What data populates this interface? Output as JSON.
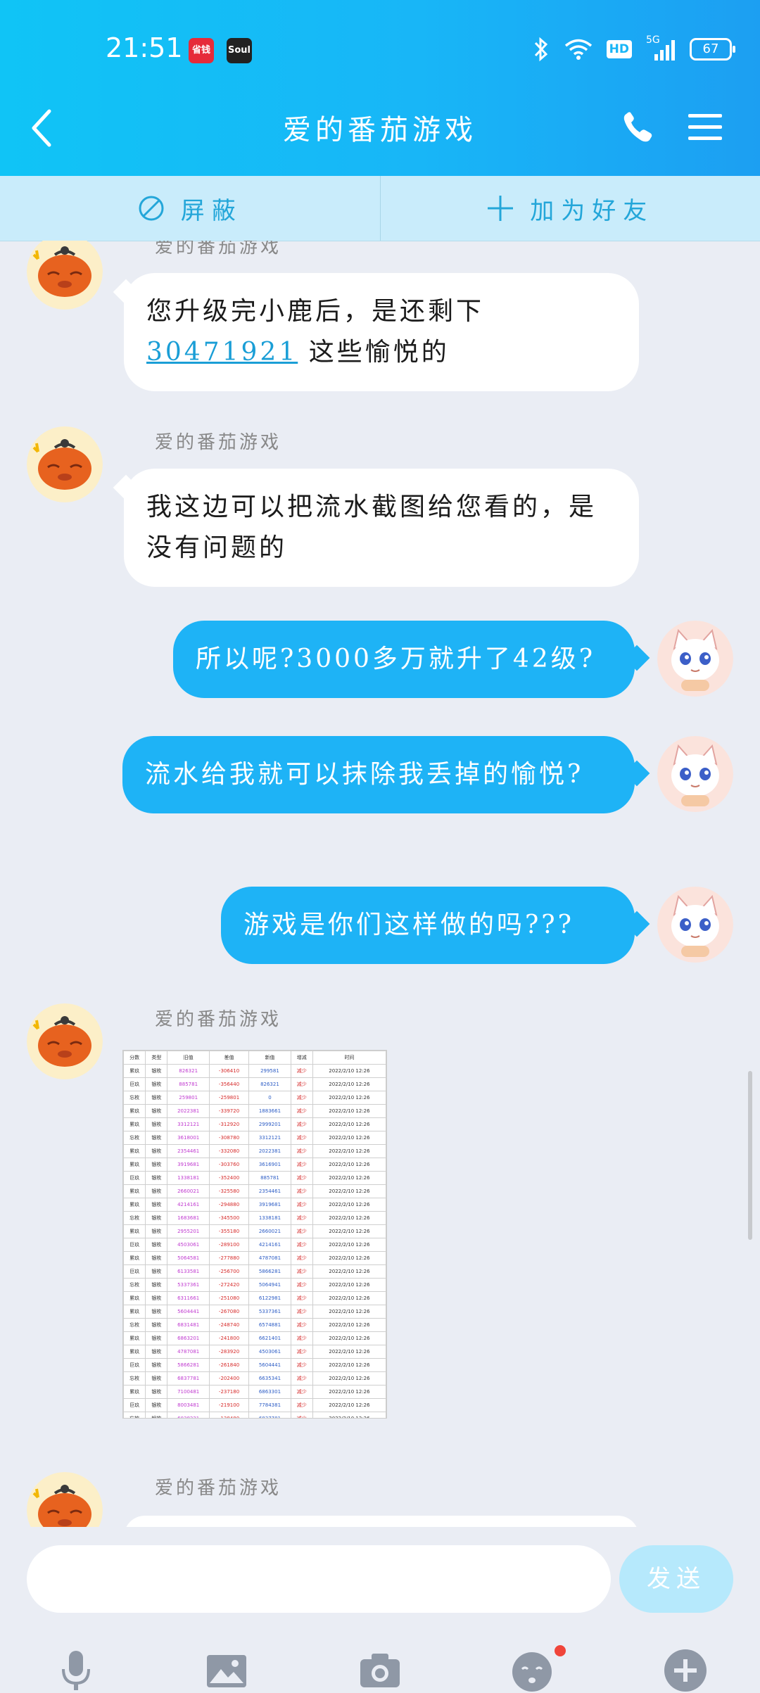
{
  "status_bar": {
    "time": "21:51",
    "app_badge_1": "省钱",
    "app_badge_2": "Soul",
    "network": "5G",
    "hd": "HD",
    "battery": "67"
  },
  "header": {
    "title": "爱的番茄游戏"
  },
  "actions": {
    "block_label": "屏蔽",
    "add_friend_label": "加为好友"
  },
  "messages": [
    {
      "from": "爱的番茄游戏",
      "text_before": "您升级完小鹿后，是还剩下",
      "link": "30471921",
      "text_after": "这些愉悦的"
    },
    {
      "from": "爱的番茄游戏",
      "text": "我这边可以把流水截图给您看的，是没有问题的"
    },
    {
      "from": "me",
      "text": "所以呢?3000多万就升了42级?"
    },
    {
      "from": "me",
      "text": "流水给我就可以抹除我丢掉的愉悦?"
    },
    {
      "from": "me",
      "text": "游戏是你们这样做的吗???"
    },
    {
      "from": "爱的番茄游戏",
      "type": "image"
    },
    {
      "from": "爱的番茄游戏"
    }
  ],
  "sheet": {
    "headers": [
      "分数",
      "类型",
      "旧值",
      "差值",
      "新值",
      "增减",
      "时间"
    ],
    "rows": [
      [
        "累玖",
        "银枚",
        "826321",
        "-306410",
        "299581",
        "减少",
        "2022/2/10 12:26"
      ],
      [
        "巨玖",
        "银枚",
        "885781",
        "-356440",
        "826321",
        "减少",
        "2022/2/10 12:26"
      ],
      [
        "忘枚",
        "银枚",
        "259801",
        "-259801",
        "0",
        "减少",
        "2022/2/10 12:26"
      ],
      [
        "累玖",
        "银枚",
        "2022381",
        "-339720",
        "1883661",
        "减少",
        "2022/2/10 12:26"
      ],
      [
        "累玖",
        "银枚",
        "3312121",
        "-312920",
        "2999201",
        "减少",
        "2022/2/10 12:26"
      ],
      [
        "忘枚",
        "银枚",
        "3618001",
        "-308780",
        "3312121",
        "减少",
        "2022/2/10 12:26"
      ],
      [
        "累玖",
        "银枚",
        "2354461",
        "-332080",
        "2022381",
        "减少",
        "2022/2/10 12:26"
      ],
      [
        "累玖",
        "银枚",
        "3919681",
        "-303760",
        "3616901",
        "减少",
        "2022/2/10 12:26"
      ],
      [
        "巨玖",
        "银枚",
        "1338181",
        "-352400",
        "885781",
        "减少",
        "2022/2/10 12:26"
      ],
      [
        "累玖",
        "银枚",
        "2660021",
        "-325580",
        "2354461",
        "减少",
        "2022/2/10 12:26"
      ],
      [
        "累玖",
        "银枚",
        "4214161",
        "-294880",
        "3919681",
        "减少",
        "2022/2/10 12:26"
      ],
      [
        "忘枚",
        "银枚",
        "1683681",
        "-345500",
        "1338181",
        "减少",
        "2022/2/10 12:26"
      ],
      [
        "累玖",
        "银枚",
        "2955201",
        "-355180",
        "2660021",
        "减少",
        "2022/2/10 12:26"
      ],
      [
        "巨玖",
        "银枚",
        "4503061",
        "-289100",
        "4214161",
        "减少",
        "2022/2/10 12:26"
      ],
      [
        "累玖",
        "银枚",
        "5064581",
        "-277880",
        "4787081",
        "减少",
        "2022/2/10 12:26"
      ],
      [
        "巨玖",
        "银枚",
        "6133581",
        "-256700",
        "5866281",
        "减少",
        "2022/2/10 12:26"
      ],
      [
        "忘枚",
        "银枚",
        "5337361",
        "-272420",
        "5064941",
        "减少",
        "2022/2/10 12:26"
      ],
      [
        "累玖",
        "银枚",
        "6311661",
        "-251080",
        "6122981",
        "减少",
        "2022/2/10 12:26"
      ],
      [
        "累玖",
        "银枚",
        "5604441",
        "-267080",
        "5337361",
        "减少",
        "2022/2/10 12:26"
      ],
      [
        "忘枚",
        "银枚",
        "6831481",
        "-248740",
        "6574881",
        "减少",
        "2022/2/10 12:26"
      ],
      [
        "累玖",
        "银枚",
        "6863201",
        "-241800",
        "6621401",
        "减少",
        "2022/2/10 12:26"
      ],
      [
        "累玖",
        "银枚",
        "4787081",
        "-283920",
        "4503061",
        "减少",
        "2022/2/10 12:26"
      ],
      [
        "巨玖",
        "银枚",
        "5866281",
        "-261840",
        "5604441",
        "减少",
        "2022/2/10 12:26"
      ],
      [
        "忘枚",
        "银枚",
        "6837781",
        "-202400",
        "6635341",
        "减少",
        "2022/2/10 12:26"
      ],
      [
        "累玖",
        "银枚",
        "7100481",
        "-237180",
        "6863301",
        "减少",
        "2022/2/10 12:26"
      ],
      [
        "巨玖",
        "银枚",
        "8003481",
        "-219100",
        "7784381",
        "减少",
        "2022/2/10 12:26"
      ],
      [
        "忘枚",
        "银枚",
        "6038221",
        "-138480",
        "6837781",
        "减少",
        "2022/2/10 12:26"
      ]
    ]
  },
  "composer": {
    "send_label": "发送"
  },
  "colors": {
    "header_gradient_start": "#10c4f6",
    "header_gradient_end": "#1c9ff2",
    "outgoing_bubble": "#1eb3f6",
    "action_bar": "#c9ecfb",
    "send_button": "#b6e9fc",
    "notification_dot": "#f0453a"
  },
  "icons": {
    "back": "chevron-left-icon",
    "call": "phone-icon",
    "menu": "hamburger-menu-icon",
    "block": "block-circle-icon",
    "add": "plus-icon",
    "mic": "microphone-icon",
    "picture": "image-icon",
    "camera": "camera-icon",
    "emoji": "emoji-icon",
    "more": "plus-circle-icon"
  }
}
